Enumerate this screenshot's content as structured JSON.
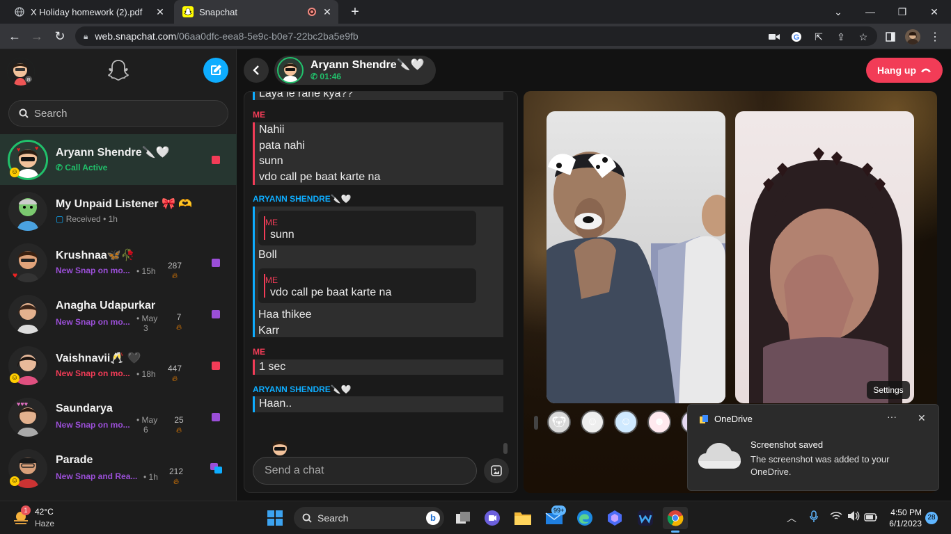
{
  "browser": {
    "tabs": [
      {
        "title": "X Holiday homework (2).pdf",
        "icon": "globe-icon"
      },
      {
        "title": "Snapchat",
        "icon": "snapchat-icon",
        "recording": true
      }
    ],
    "url_host": "web.snapchat.com",
    "url_path": "/06aa0dfc-eea8-5e9c-b0e7-22bc2ba5e9fb"
  },
  "sidebar": {
    "search_placeholder": "Search",
    "chats": [
      {
        "name": "Aryann Shendre🔪🤍",
        "status": "Call Active",
        "status_color": "#21c16b",
        "square": "#f23c57",
        "active": true
      },
      {
        "name": "My Unpaid Listener 🎀 🫶",
        "status": "Received",
        "time": "1h",
        "status_color": "#9e9e9e"
      },
      {
        "name": "Krushnaa🦋🥀",
        "status": "New Snap on mo...",
        "time": "15h",
        "streak": "287",
        "square": "#9b4fd8",
        "status_color": "#9b4fd8"
      },
      {
        "name": "Anagha Udapurkar",
        "status": "New Snap on mo...",
        "time_l1": "May",
        "time_l2": "3",
        "streak": "7",
        "square": "#9b4fd8",
        "status_color": "#9b4fd8"
      },
      {
        "name": "Vaishnavii🥂 🖤",
        "status": "New Snap on mo...",
        "time": "18h",
        "streak": "447",
        "square": "#f23c57",
        "status_color": "#f23c57"
      },
      {
        "name": "Saundarya",
        "status": "New Snap on mo...",
        "time_l1": "May",
        "time_l2": "6",
        "streak": "25",
        "square": "#9b4fd8",
        "status_color": "#9b4fd8"
      },
      {
        "name": "Parade",
        "status": "New Snap and Rea...",
        "time": "1h",
        "streak": "212",
        "status_color": "#9b4fd8"
      }
    ]
  },
  "call": {
    "contact": "Aryann Shendre🔪🤍",
    "duration": "01:46",
    "hangup_label": "Hang up"
  },
  "messages": {
    "top_partial": "Laya le rahe kya??",
    "me_label": "ME",
    "them_label": "ARYANN SHENDRE🔪🤍",
    "block1": [
      "Nahii",
      "pata nahi",
      "sunn",
      "vdo call pe baat karte na"
    ],
    "quote1_label": "ME",
    "quote1_text": "sunn",
    "reply1": "Boll",
    "quote2_label": "ME",
    "quote2_text": "vdo call pe baat karte na",
    "block2": [
      "Haa thikee",
      "Karr"
    ],
    "block3": [
      "1 sec"
    ],
    "block4": [
      "Haan.."
    ],
    "input_placeholder": "Send a chat"
  },
  "video": {
    "settings_label": "Settings"
  },
  "toast": {
    "app": "OneDrive",
    "title": "Screenshot saved",
    "body_l1": "The screenshot was added to your",
    "body_l2": "OneDrive."
  },
  "taskbar": {
    "weather_temp": "42°C",
    "weather_cond": "Haze",
    "weather_badge": "1",
    "search_label": "Search",
    "mail_badge": "99+",
    "time": "4:50 PM",
    "date": "6/1/2023",
    "notif_count": "28"
  },
  "colors": {
    "me": "#f23c57",
    "them": "#0eadff",
    "call_green": "#21c16b",
    "snap_purple": "#9b4fd8"
  }
}
